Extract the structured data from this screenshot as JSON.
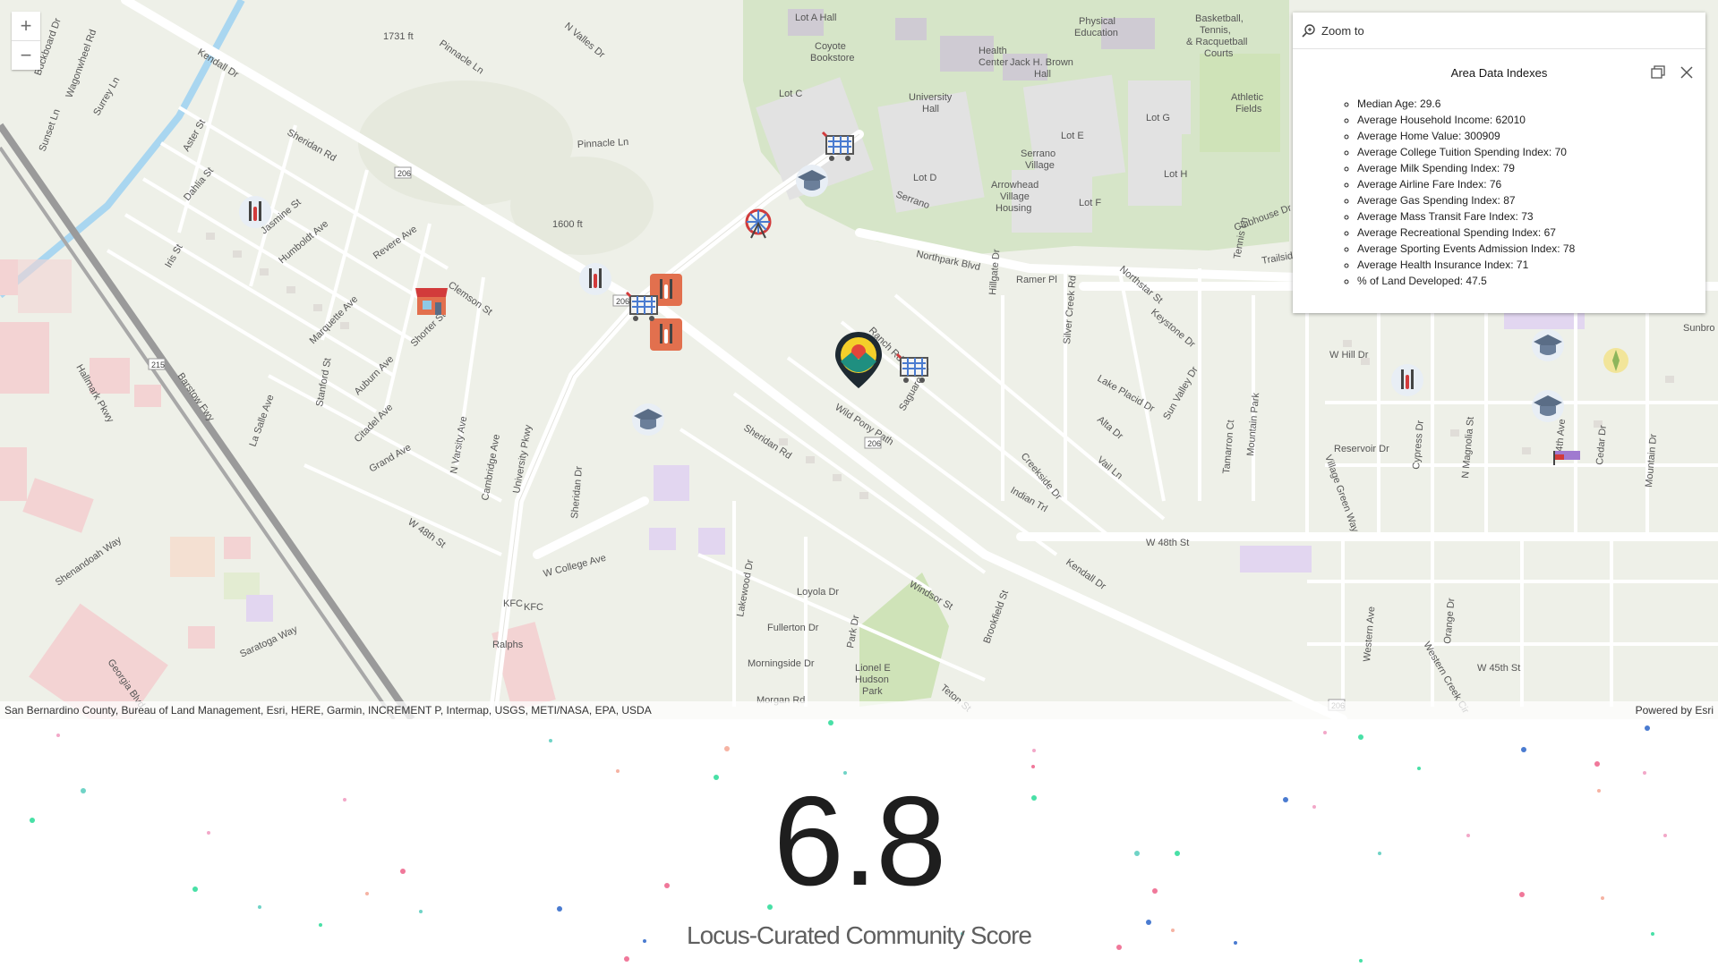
{
  "map": {
    "attribution": "San Bernardino County, Bureau of Land Management, Esri, HERE, Garmin, INCREMENT P, Intermap, USGS, METI/NASA, EPA, USDA",
    "powered_by": "Powered by Esri",
    "zoom_in": "+",
    "zoom_out": "−",
    "labels": [
      "Kendall Dr",
      "Pinnacle Ln",
      "N Valles Dr",
      "Sheridan Rd",
      "Jasmine St",
      "Dahlia St",
      "Humboldt Ave",
      "Revere Ave",
      "Clemson St",
      "Marquette Ave",
      "Shorter St",
      "Auburn Ave",
      "Citadel Ave",
      "Grand Ave",
      "W 48th St",
      "W College Ave",
      "N Varsity Ave",
      "Cambridge Ave",
      "University Pkwy",
      "Sheridan Dr",
      "Lakewood Dr",
      "Loyola Dr",
      "Fullerton Dr",
      "Morningside Dr",
      "Park Dr",
      "Windsor St",
      "Brookfield St",
      "Indian Trl",
      "Creekside Dr",
      "Wild Pony Path",
      "Saguaro St",
      "Ranch Rd",
      "Northpark Blvd",
      "Serrano",
      "Lot C",
      "Lot D",
      "Lot E",
      "Lot F",
      "Lot G",
      "Lot H",
      "Athletic Fields",
      "University Hall",
      "Coyote Bookstore",
      "Health Center",
      "Jack H. Brown Hall",
      "Physical Education",
      "Arrowhead Village Housing",
      "Serrano Village",
      "Hillgate Dr",
      "Ramer Pl",
      "Silver Creek Rd",
      "Northstar St",
      "Keystone Dr",
      "Lake Placid Dr",
      "Alta Dr",
      "Vail Ln",
      "Sun Valley Dr",
      "Tamarron Ct",
      "Mountain Park",
      "W Hill Dr",
      "Reservoir Dr",
      "Cypress Dr",
      "N Magnolia St",
      "Cedar Dr",
      "4th Ave",
      "Mountain Dr",
      "Village Green Way",
      "W 48th St",
      "Western Ave",
      "Orange Dr",
      "W 45th St",
      "Western Creek Cir",
      "Sunbro",
      "Lionel E Hudson Park",
      "Teton St",
      "Morgan Rd",
      "KFC",
      "Ralphs",
      "Saratoga Way",
      "Georgia Blvd",
      "Shenandoah Way",
      "Hallmark Pkwy",
      "Barstow Fwy",
      "La Salle Ave",
      "Stanford St",
      "Iris St",
      "Aster St",
      "Buckboard Dr",
      "Wagonwheel Rd",
      "Surrey Ln",
      "Sunset Ln",
      "1731 ft",
      "1600 ft",
      "206",
      "215",
      "Clubhouse Dr",
      "Trailside Pl",
      "Tennis Ln",
      "Basketball, Tennis, & Racquetball Courts",
      "Lot A Hall"
    ]
  },
  "popup": {
    "zoom_to": "Zoom to",
    "title": "Area Data Indexes",
    "items": [
      "Median Age: 29.6",
      "Average Household Income: 62010",
      "Average Home Value: 300909",
      "Average College Tuition Spending Index: 70",
      "Average Milk Spending Index: 79",
      "Average Airline Fare Index: 76",
      "Average Gas Spending Index: 87",
      "Average Mass Transit Fare Index: 73",
      "Average Recreational Spending Index: 67",
      "Average Sporting Events Admission Index: 78",
      "Average Health Insurance Index: 71",
      "% of Land Developed: 47.5"
    ]
  },
  "score": {
    "value": "6.8",
    "label": "Locus-Curated Community Score"
  },
  "colors": {
    "map_bg": "#eef0e8",
    "road": "#ffffff",
    "road_outline": "#d5d5d0",
    "campus": "#cfe0c0",
    "building": "#d9d4dc",
    "pink_zone": "#f3cccc",
    "score_text": "#1e1e1e",
    "label_text": "#5f5f5f"
  }
}
